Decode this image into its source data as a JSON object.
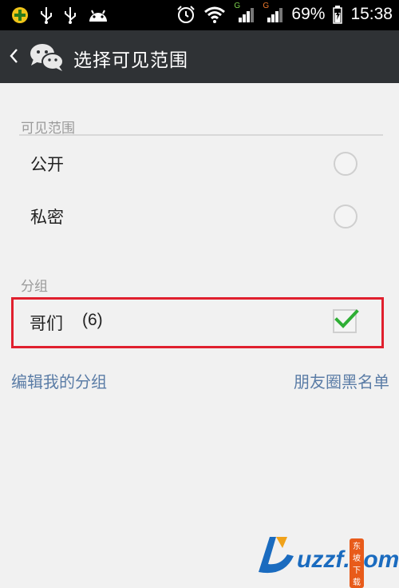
{
  "status_bar": {
    "icons": [
      "plus-circle-icon",
      "usb-icon",
      "usb-icon",
      "android-icon",
      "alarm-icon",
      "wifi-icon",
      "signal-icon",
      "signal-icon",
      "battery-charging-icon"
    ],
    "network_badge_1": "G",
    "network_badge_2": "G",
    "battery": "69%",
    "time": "15:38"
  },
  "header": {
    "title": "选择可见范围"
  },
  "visibility": {
    "section_label": "可见范围",
    "options": [
      {
        "label": "公开",
        "selected": false
      },
      {
        "label": "私密",
        "selected": false
      }
    ]
  },
  "groups": {
    "section_label": "分组",
    "items": [
      {
        "name": "哥们",
        "count": "(6)",
        "checked": true
      }
    ]
  },
  "footer_links": {
    "edit_groups": "编辑我的分组",
    "blacklist": "朋友圈黑名单"
  },
  "watermark": {
    "text": "uzzf.com",
    "badge": "东坡下载"
  },
  "colors": {
    "accent_check": "#2eae34",
    "highlight_border": "#e0202e",
    "link": "#5a7ca6",
    "titlebar": "#2f3235"
  }
}
